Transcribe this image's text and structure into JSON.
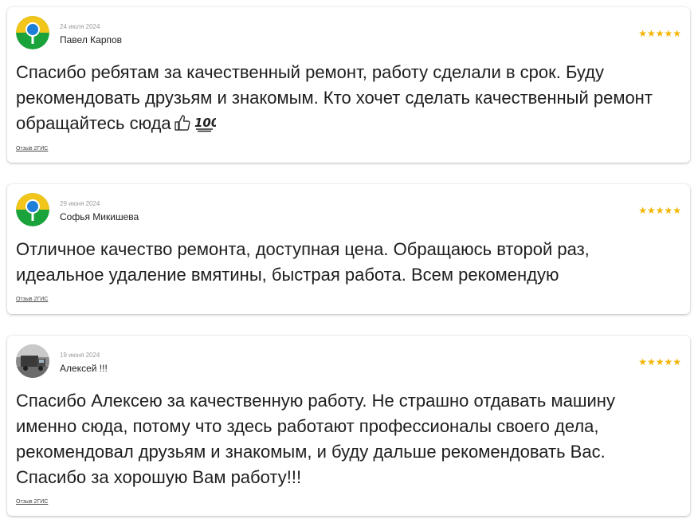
{
  "reviews": [
    {
      "date": "24 июля 2024",
      "author": "Павел Карпов",
      "stars": "★★★★★",
      "rating": 5,
      "text": "Спасибо ребятам за качественный ремонт, работу сделали в срок. Буду рекомендовать друзьям и знакомым. Кто хочет сделать качественный ремонт обращайтесь сюда",
      "source": "Отзыв 2ГИС",
      "avatar_icon": "2gis-logo-icon",
      "trailing_icons": [
        "thumbs-up-icon",
        "hundred-points-icon"
      ]
    },
    {
      "date": "29 июня 2024",
      "author": "Софья Микишева",
      "stars": "★★★★★",
      "rating": 5,
      "text": "Отличное качество ремонта, доступная цена. Обращаюсь второй раз, идеальное удаление вмятины, быстрая работа. Всем рекомендую",
      "source": "Отзыв 2ГИС",
      "avatar_icon": "2gis-logo-icon"
    },
    {
      "date": "19 июня 2024",
      "author": "Алексей !!!",
      "stars": "★★★★★",
      "rating": 5,
      "text": "Спасибо Алексею за качественную работу. Не страшно отдавать машину именно сюда, потому что здесь работают профессионалы своего дела, рекомендовал друзьям и знакомым, и буду дальше рекомендовать Вас. Спасибо за хорошую Вам работу!!!",
      "source": "Отзыв 2ГИС",
      "avatar_icon": "user-photo-truck"
    }
  ],
  "colors": {
    "star": "#f4b400",
    "logo_green": "#1aa33a",
    "logo_yellow": "#f2c51b",
    "logo_blue": "#1e7fd9"
  }
}
